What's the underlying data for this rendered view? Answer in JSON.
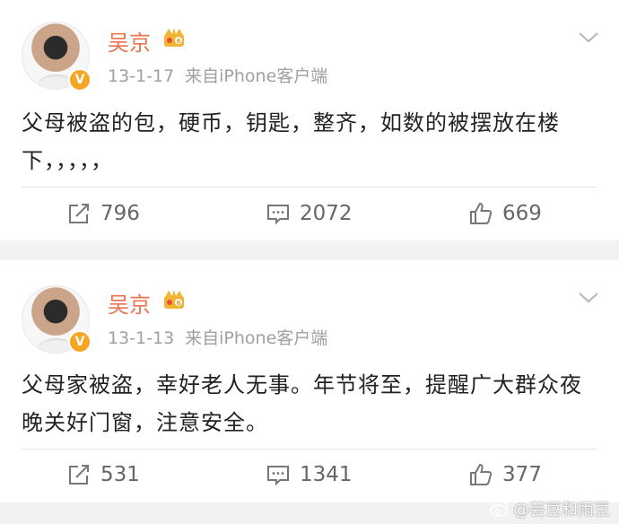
{
  "posts": [
    {
      "username": "吴京",
      "date": "13-1-17",
      "source": "来自iPhone客户端",
      "verified_badge": "V",
      "content": "父母被盗的包，硬币，钥匙，整齐，如数的被摆放在楼下，，，，，",
      "reposts": "796",
      "comments": "2072",
      "likes": "669"
    },
    {
      "username": "吴京",
      "date": "13-1-13",
      "source": "来自iPhone客户端",
      "verified_badge": "V",
      "content": "父母家被盗，幸好老人无事。年节将至，提醒广大群众夜晚关好门窗，注意安全。",
      "reposts": "531",
      "comments": "1341",
      "likes": "377"
    }
  ],
  "watermark": "@芸豆和雨豆",
  "colors": {
    "username": "#eb7350",
    "meta": "#a0a0a0",
    "badge": "#f6a623",
    "separator": "#f2f2f2"
  },
  "icons": {
    "repost": "repost-icon",
    "comment": "comment-icon",
    "like": "like-icon",
    "more": "chevron-down-icon",
    "member": "crown-icon"
  }
}
